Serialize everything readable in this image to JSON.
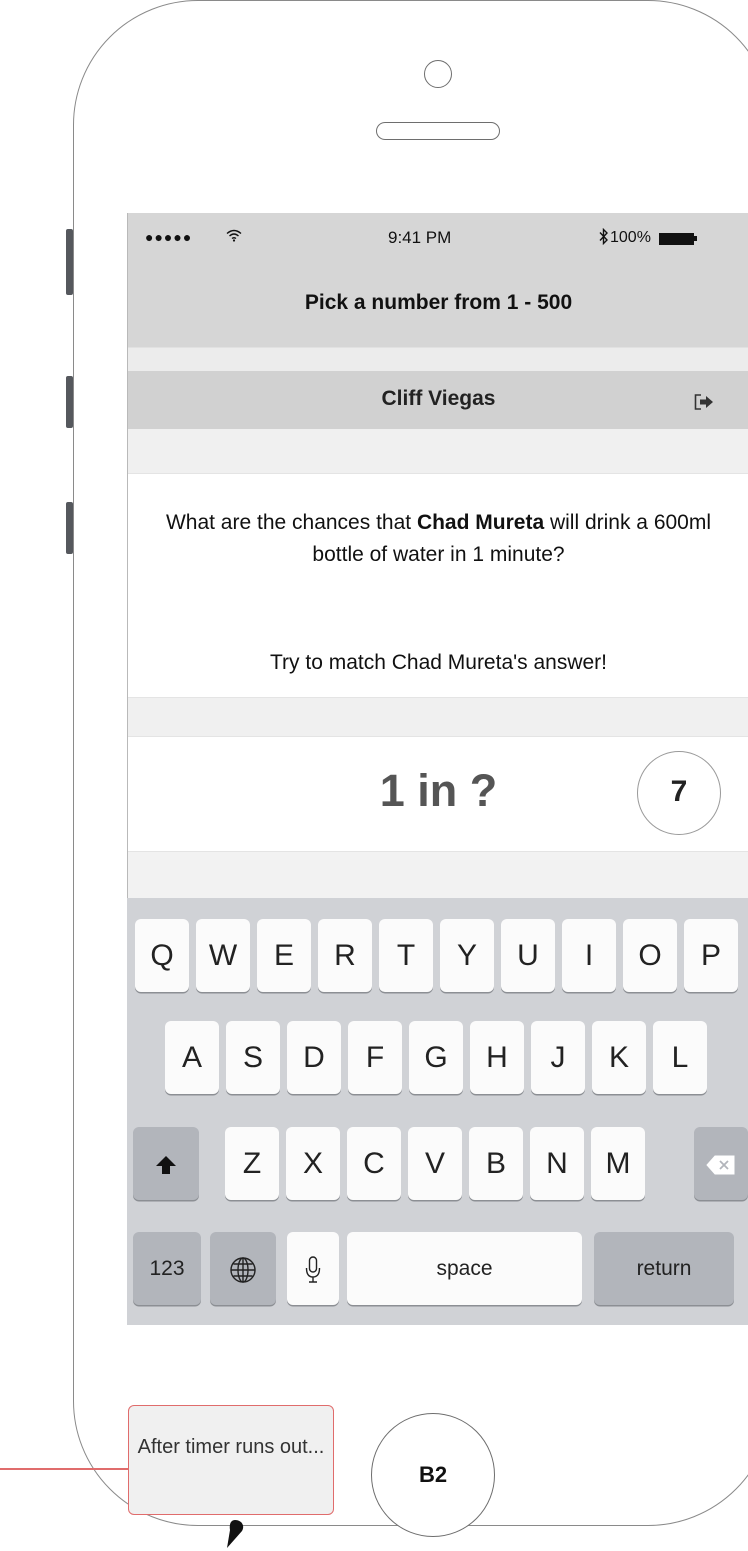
{
  "status_bar": {
    "signal": "●●●●● ",
    "time": "9:41 PM",
    "battery": "100%"
  },
  "header": {
    "title": "Pick a number from 1 - 500"
  },
  "user": {
    "name": "Cliff Viegas"
  },
  "question": {
    "prefix": "What are the chances that ",
    "person": "Chad Mureta",
    "suffix": " will drink a 600ml bottle of water in 1 minute?",
    "hint": "Try to match Chad Mureta's answer!"
  },
  "answer": {
    "prompt": "1 in ?",
    "timer": "7"
  },
  "keyboard": {
    "row1": [
      "Q",
      "W",
      "E",
      "R",
      "T",
      "Y",
      "U",
      "I",
      "O",
      "P"
    ],
    "row2": [
      "A",
      "S",
      "D",
      "F",
      "G",
      "H",
      "J",
      "K",
      "L"
    ],
    "row3": [
      "Z",
      "X",
      "C",
      "V",
      "B",
      "N",
      "M"
    ],
    "numbers_label": "123",
    "space_label": "space",
    "return_label": "return"
  },
  "annotation": {
    "note": "After timer runs out...",
    "badge": "B2"
  },
  "icons": {
    "wifi": "wifi-icon",
    "bluetooth": "bluetooth-icon",
    "battery": "battery-icon",
    "logout": "logout-icon",
    "shift": "shift-icon",
    "delete": "backspace-icon",
    "globe": "globe-icon",
    "mic": "microphone-icon",
    "pin": "map-pin-icon"
  },
  "colors": {
    "annotation_border": "#e06c6c",
    "keyboard_bg": "#d0d2d6",
    "bar_bg": "#d6d6d6"
  }
}
